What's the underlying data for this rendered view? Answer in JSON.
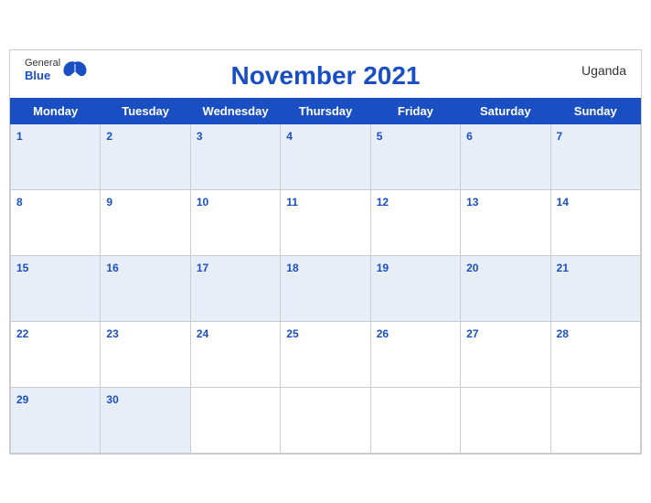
{
  "header": {
    "logo_general": "General",
    "logo_blue": "Blue",
    "title": "November 2021",
    "country": "Uganda"
  },
  "weekdays": [
    "Monday",
    "Tuesday",
    "Wednesday",
    "Thursday",
    "Friday",
    "Saturday",
    "Sunday"
  ],
  "weeks": [
    [
      1,
      2,
      3,
      4,
      5,
      6,
      7
    ],
    [
      8,
      9,
      10,
      11,
      12,
      13,
      14
    ],
    [
      15,
      16,
      17,
      18,
      19,
      20,
      21
    ],
    [
      22,
      23,
      24,
      25,
      26,
      27,
      28
    ],
    [
      29,
      30,
      null,
      null,
      null,
      null,
      null
    ]
  ]
}
